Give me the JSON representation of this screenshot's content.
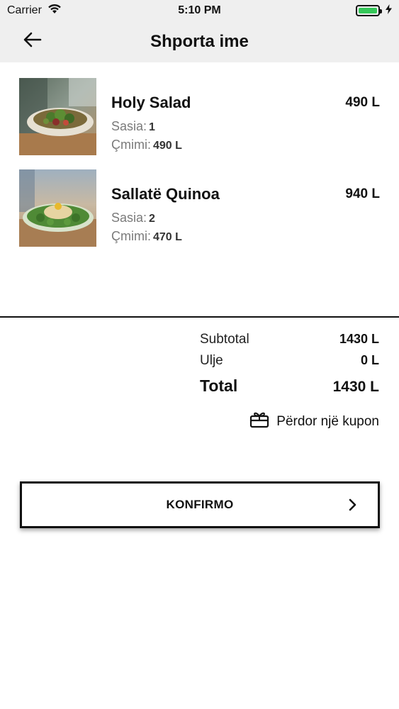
{
  "status_bar": {
    "carrier": "Carrier",
    "time": "5:10 PM",
    "battery_level": 1.0,
    "battery_color": "#35c759"
  },
  "nav": {
    "title": "Shporta ime",
    "back_icon": "arrow-left-icon"
  },
  "cart": {
    "quantity_label": "Sasia:",
    "price_label": "Çmimi:",
    "items": [
      {
        "name": "Holy Salad",
        "total": "490 L",
        "quantity": "1",
        "price": "490 L",
        "image": "salad-photo"
      },
      {
        "name": "Sallatë Quinoa",
        "total": "940 L",
        "quantity": "2",
        "price": "470 L",
        "image": "quinoa-salad-photo"
      }
    ]
  },
  "summary": {
    "subtotal_label": "Subtotal",
    "subtotal_value": "1430 L",
    "discount_label": "Ulje",
    "discount_value": "0 L",
    "total_label": "Total",
    "total_value": "1430 L"
  },
  "coupon": {
    "label": "Përdor një kupon",
    "icon": "gift-card-icon"
  },
  "confirm": {
    "label": "KONFIRMO",
    "icon": "chevron-right-icon"
  }
}
